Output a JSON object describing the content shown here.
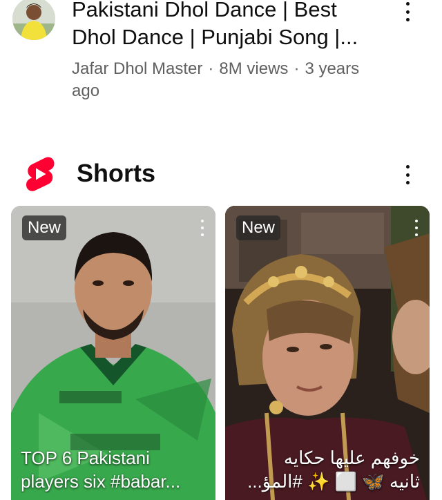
{
  "video": {
    "title": "Pakistani Dhol Dance | Best Dhol Dance | Punjabi Song |...",
    "channel": "Jafar Dhol Master",
    "views": "8M views",
    "age": "3 years ago",
    "separator": "·"
  },
  "shorts": {
    "heading": "Shorts",
    "brand_color": "#ff0033",
    "items": [
      {
        "badge": "New",
        "caption_line1": "TOP 6 Pakistani",
        "caption_line2": "players six #babar..."
      },
      {
        "badge": "New",
        "caption_line1": "خوفهم عليها حكايه",
        "caption_line2": "ثانيه 🦋 ⬜ ✨ #المؤ..."
      }
    ]
  },
  "icons": {
    "more": "more-vert-icon",
    "shorts": "shorts-logo-icon"
  }
}
